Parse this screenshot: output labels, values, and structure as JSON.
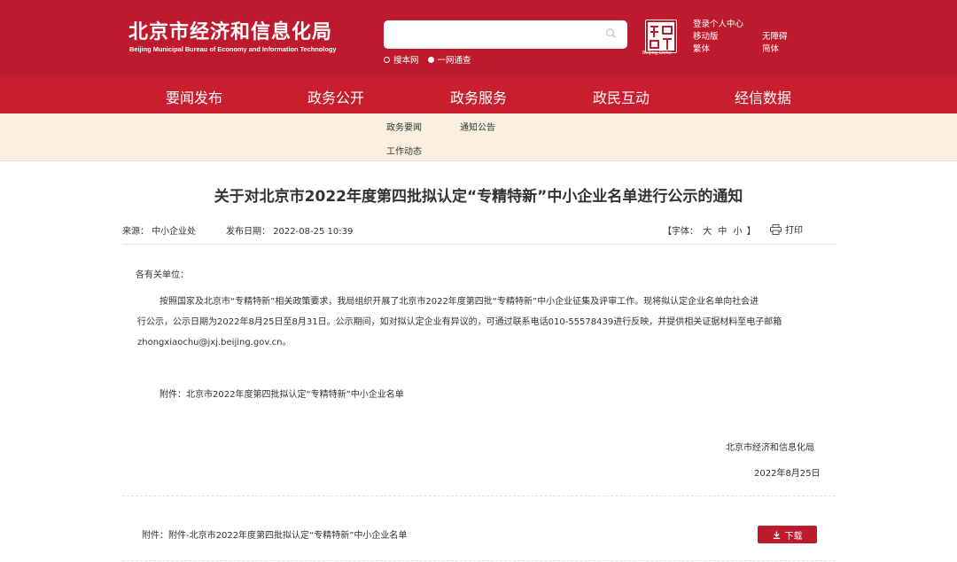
{
  "header": {
    "title_cn": "北京市经济和信息化局",
    "title_en": "Beijing Municipal Bureau of Economy and Information Technology",
    "search": {
      "placeholder": ""
    },
    "radio_options": [
      {
        "label": "搜本网",
        "selected": false
      },
      {
        "label": "一网通查",
        "selected": true
      }
    ],
    "seal_text": "Beijing·China",
    "links_col1": [
      "登录个人中心",
      "移动版",
      "繁体"
    ],
    "links_col2": [
      "无障碍",
      "简体"
    ]
  },
  "nav": {
    "items": [
      "要闻发布",
      "政务公开",
      "政务服务",
      "政民互动",
      "经信数据"
    ],
    "active_index": 0
  },
  "subnav": {
    "items": [
      "政务要闻",
      "通知公告",
      "工作动态"
    ]
  },
  "article": {
    "title": "关于对北京市2022年度第四批拟认定“专精特新”中小企业名单进行公示的通知",
    "source_label": "来源：",
    "source": "中小企业处",
    "date_label": "发布日期：",
    "date": "2022-08-25 10:39",
    "font_label": "【字体：",
    "font_sizes": [
      "大",
      "中",
      "小"
    ],
    "font_close": "】",
    "print_label": "打印",
    "salutation": "各有关单位：",
    "paragraph_lines": [
      "按照国家及北京市“专精特新”相关政策要求，我局组织开展了北京市2022年度第四批“专精特新”中小企业征集及评审工作。现将拟认定企业名单向社会进",
      "行公示，公示日期为2022年8月25日至8月31日。公示期间，如对拟认定企业有异议的，可通过联系电话010-55578439进行反映，并提供相关证据材料至电子邮箱",
      "zhongxiaochu@jxj.beijing.gov.cn。"
    ],
    "attachment_text": "附件：北京市2022年度第四批拟认定“专精特新”中小企业名单",
    "signature": "北京市经济和信息化局",
    "sign_date": "2022年8月25日",
    "attachment_download_label": "附件：附件-北京市2022年度第四批拟认定“专精特新”中小企业名单",
    "download_label": "下载"
  },
  "colors": {
    "header_red": "#bd1b2d",
    "nav_red": "#c81e2e",
    "subnav_bg": "#fbf0df"
  },
  "icons": [
    "search-icon",
    "seal-logo-icon",
    "printer-icon",
    "download-icon"
  ]
}
